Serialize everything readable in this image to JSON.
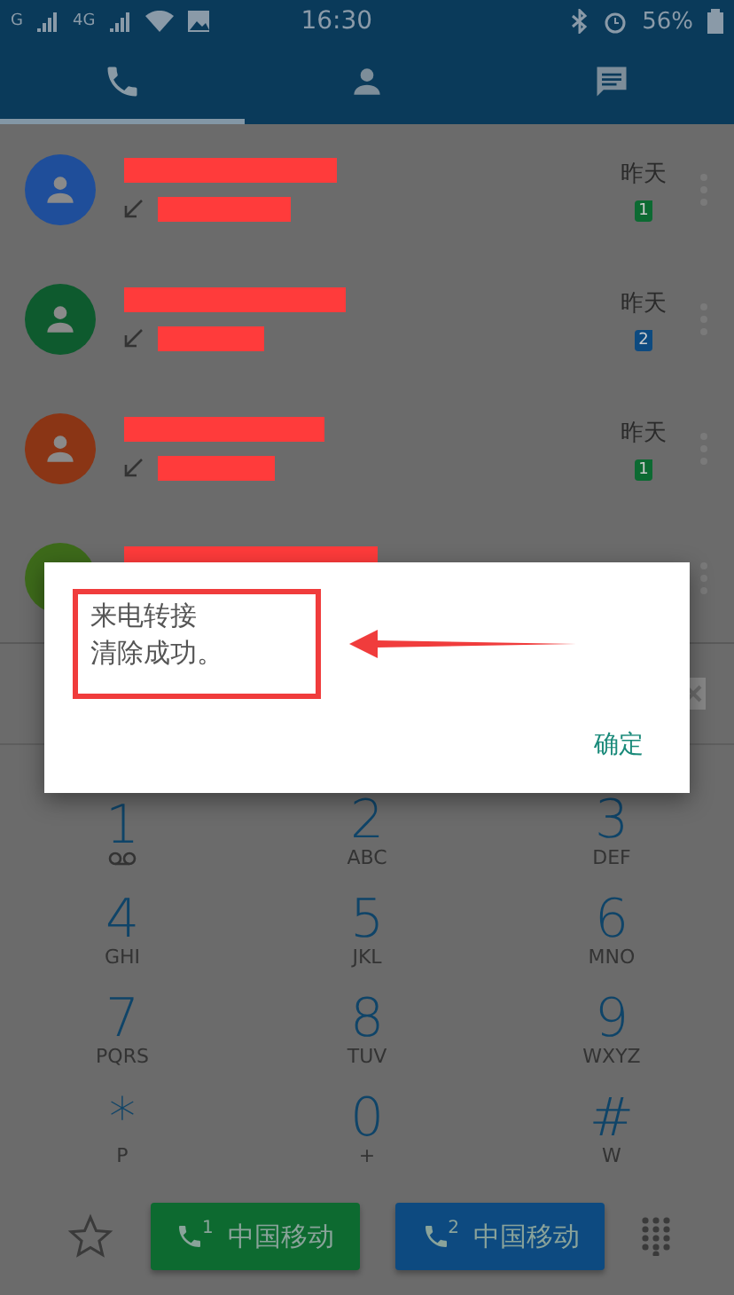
{
  "status_bar": {
    "sim1_network": "G",
    "sim2_network": "4G",
    "time": "16:30",
    "battery": "56%"
  },
  "tabs": [
    {
      "kind": "phone",
      "selected": true
    },
    {
      "kind": "contacts",
      "selected": false
    },
    {
      "kind": "messages",
      "selected": false
    }
  ],
  "calls": [
    {
      "color": "#1f4e9a",
      "time": "昨天",
      "sim_badge": {
        "number": "1",
        "color": "#0c6a32"
      }
    },
    {
      "color": "#0e5a2e",
      "time": "昨天",
      "sim_badge": {
        "number": "2",
        "color": "#0d4a80"
      }
    },
    {
      "color": "#8a3515",
      "time": "昨天",
      "sim_badge": {
        "number": "1",
        "color": "#0c6a32"
      }
    },
    {
      "color": "#3d6a1a"
    }
  ],
  "dialog": {
    "message_lines": [
      "来电转接",
      "清除成功。"
    ],
    "button": "确定"
  },
  "keypad": [
    {
      "digit": "1",
      "kind": "voicemail"
    },
    {
      "digit": "2",
      "letters": "ABC"
    },
    {
      "digit": "3",
      "letters": "DEF"
    },
    {
      "digit": "4",
      "letters": "GHI"
    },
    {
      "digit": "5",
      "letters": "JKL"
    },
    {
      "digit": "6",
      "letters": "MNO"
    },
    {
      "digit": "7",
      "letters": "PQRS"
    },
    {
      "digit": "8",
      "letters": "TUV"
    },
    {
      "digit": "9",
      "letters": "WXYZ"
    },
    {
      "digit": "*",
      "letters": "P"
    },
    {
      "digit": "0",
      "letters": "+"
    },
    {
      "digit": "#",
      "letters": "W"
    }
  ],
  "call_buttons": [
    {
      "sim": "1",
      "label": "中国移动",
      "color": "#0d6a30"
    },
    {
      "sim": "2",
      "label": "中国移动",
      "color": "#0d4a80"
    }
  ]
}
